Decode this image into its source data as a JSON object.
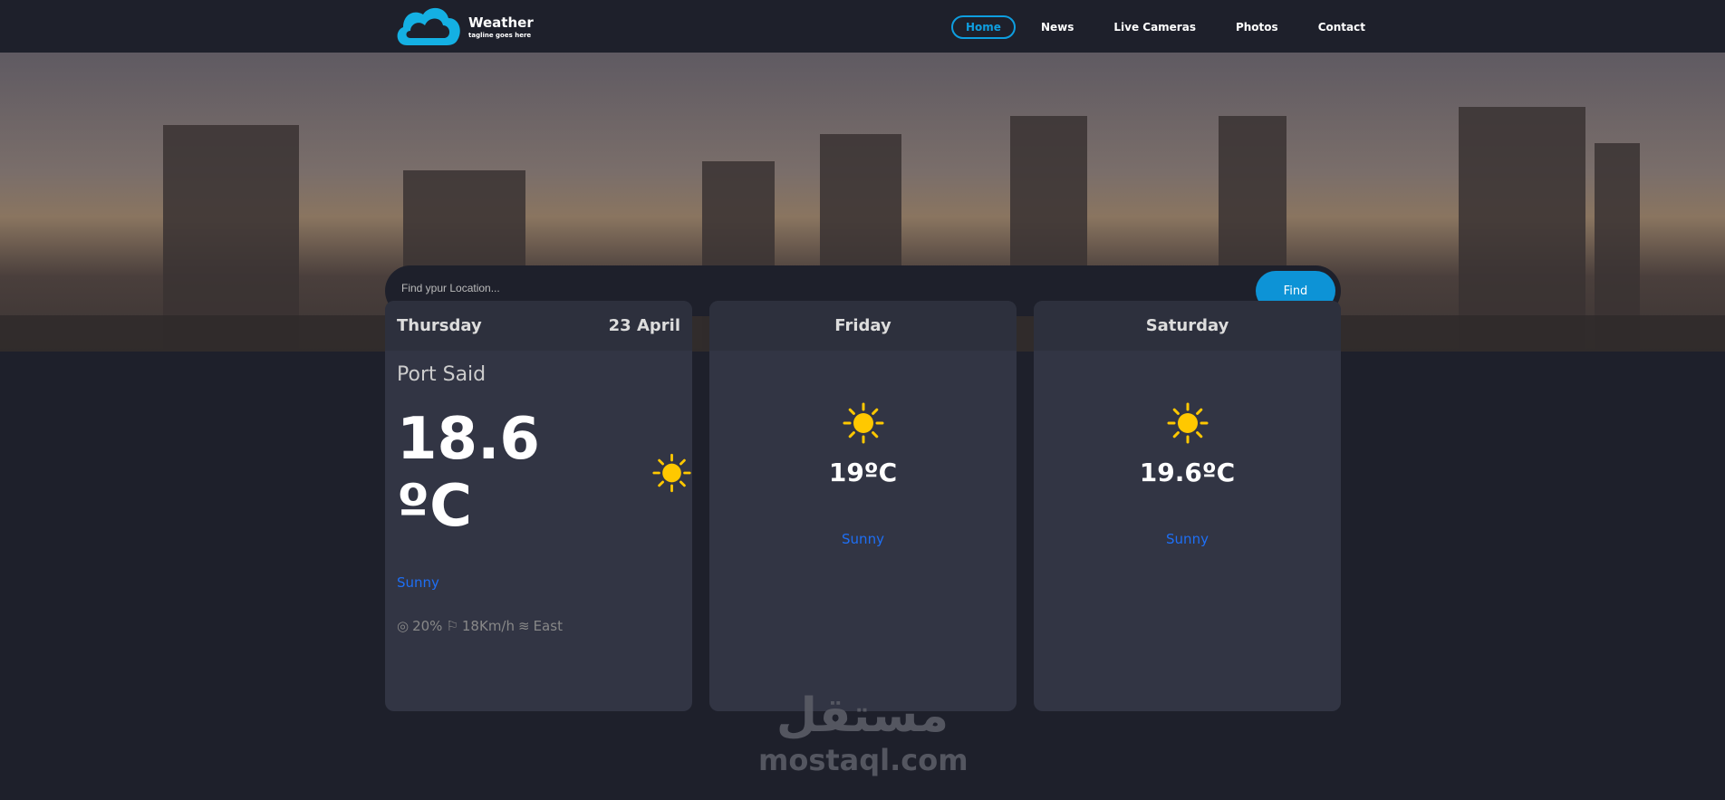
{
  "brand": {
    "title": "Weather",
    "tagline": "tagline goes here"
  },
  "nav": [
    {
      "label": "Home",
      "active": true
    },
    {
      "label": "News"
    },
    {
      "label": "Live Cameras"
    },
    {
      "label": "Photos"
    },
    {
      "label": "Contact"
    }
  ],
  "search": {
    "placeholder": "Find ypur Location...",
    "button": "Find"
  },
  "today": {
    "day": "Thursday",
    "date": "23 April",
    "city": "Port Said",
    "temp": "18.6 ºC",
    "condition": "Sunny",
    "humidity": "20%",
    "wind_speed": "18Km/h",
    "wind_dir": "East"
  },
  "forecast": [
    {
      "day": "Friday",
      "temp": "19ºC",
      "condition": "Sunny"
    },
    {
      "day": "Saturday",
      "temp": "19.6ºC",
      "condition": "Sunny"
    }
  ],
  "watermark": {
    "arabic": "مستقل",
    "latin": "mostaql.com"
  },
  "colors": {
    "accent": "#0d93d6",
    "condition": "#1e6ff5",
    "sun": "#ffc800"
  }
}
